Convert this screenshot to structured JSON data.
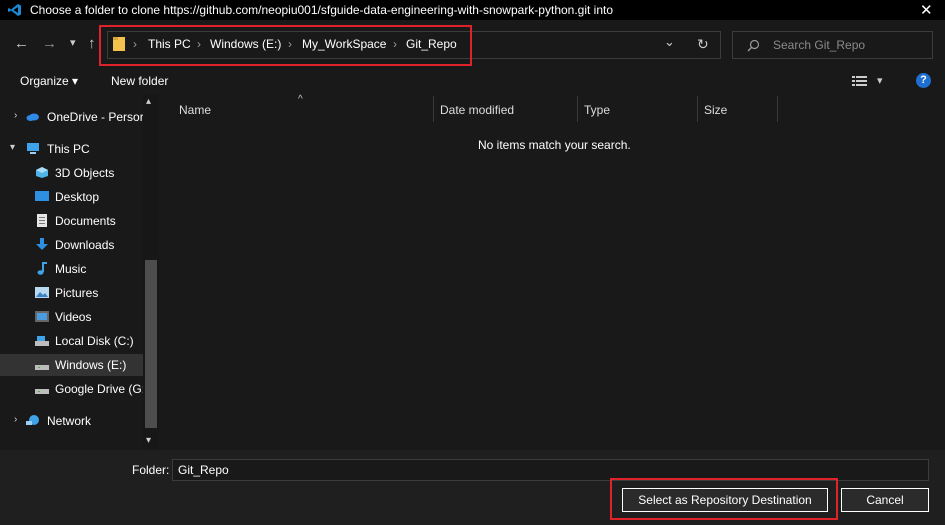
{
  "window": {
    "title": "Choose a folder to clone https://github.com/neopiu001/sfguide-data-engineering-with-snowpark-python.git into",
    "close_glyph": "✕"
  },
  "nav": {
    "back_glyph": "←",
    "forward_glyph": "→",
    "recent_glyph": "▾",
    "up_glyph": "↑",
    "breadcrumb": [
      "This PC",
      "Windows (E:)",
      "My_WorkSpace",
      "Git_Repo"
    ],
    "separator": "›",
    "dropdown_glyph": "⌄",
    "refresh_glyph": "↻"
  },
  "search": {
    "placeholder": "Search Git_Repo"
  },
  "toolbar": {
    "organize_label": "Organize ▾",
    "new_folder_label": "New folder",
    "view_dropdown_glyph": "▾",
    "help_glyph": "?"
  },
  "sidebar": {
    "items": [
      {
        "label": "OneDrive - Persor",
        "icon": "onedrive-icon"
      },
      {
        "label": "This PC",
        "icon": "this-pc-icon"
      },
      {
        "label": "3D Objects",
        "icon": "3d-objects-icon"
      },
      {
        "label": "Desktop",
        "icon": "desktop-icon"
      },
      {
        "label": "Documents",
        "icon": "documents-icon"
      },
      {
        "label": "Downloads",
        "icon": "downloads-icon"
      },
      {
        "label": "Music",
        "icon": "music-icon"
      },
      {
        "label": "Pictures",
        "icon": "pictures-icon"
      },
      {
        "label": "Videos",
        "icon": "videos-icon"
      },
      {
        "label": "Local Disk (C:)",
        "icon": "drive-icon"
      },
      {
        "label": "Windows (E:)",
        "icon": "drive-icon"
      },
      {
        "label": "Google Drive (G:",
        "icon": "drive-icon"
      },
      {
        "label": "Network",
        "icon": "network-icon"
      }
    ],
    "chevron_glyph": "›",
    "scroll_up_glyph": "▴",
    "scroll_down_glyph": "▾"
  },
  "columns": [
    "Name",
    "Date modified",
    "Type",
    "Size"
  ],
  "sort_glyph": "^",
  "empty_message": "No items match your search.",
  "footer": {
    "folder_label": "Folder:",
    "folder_value": "Git_Repo",
    "select_button": "Select as Repository Destination",
    "cancel_button": "Cancel"
  },
  "colors": {
    "accent_red": "#e0232b",
    "vscode_blue": "#1a8ad4",
    "folder_yellow": "#f2c14e",
    "help_blue": "#1f6fd1"
  }
}
